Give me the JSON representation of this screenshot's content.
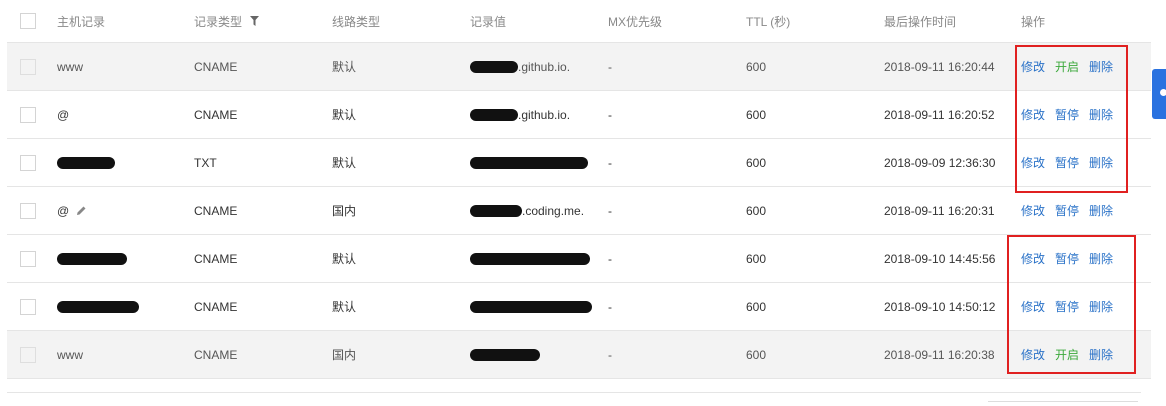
{
  "header": {
    "host": "主机记录",
    "type": "记录类型",
    "line": "线路类型",
    "value": "记录值",
    "mx": "MX优先级",
    "ttl": "TTL (秒)",
    "time": "最后操作时间",
    "op": "操作"
  },
  "colors": {
    "link": "#2a72c8",
    "enable": "#3ca93c",
    "highlight": "#e02020",
    "side_tab": "#2a72e0"
  },
  "rows": [
    {
      "host": "www",
      "host_redacted": false,
      "type": "CNAME",
      "line": "默认",
      "value_visible": ".github.io.",
      "mx": "-",
      "ttl": "600",
      "time": "2018-09-11 16:20:44",
      "edit": "修改",
      "toggle": "开启",
      "toggle_green": true,
      "del": "删除",
      "disabled": true
    },
    {
      "host": "@",
      "host_redacted": false,
      "type": "CNAME",
      "line": "默认",
      "value_visible": ".github.io.",
      "mx": "-",
      "ttl": "600",
      "time": "2018-09-11 16:20:52",
      "edit": "修改",
      "toggle": "暂停",
      "toggle_green": false,
      "del": "删除",
      "disabled": false
    },
    {
      "host": "",
      "host_redacted": true,
      "type": "TXT",
      "line": "默认",
      "value_visible": "",
      "mx": "-",
      "ttl": "600",
      "time": "2018-09-09 12:36:30",
      "edit": "修改",
      "toggle": "暂停",
      "toggle_green": false,
      "del": "删除",
      "disabled": false
    },
    {
      "host": "@",
      "host_redacted": false,
      "host_edit_icon": true,
      "type": "CNAME",
      "line": "国内",
      "value_visible": ".coding.me.",
      "mx": "-",
      "ttl": "600",
      "time": "2018-09-11 16:20:31",
      "edit": "修改",
      "toggle": "暂停",
      "toggle_green": false,
      "del": "删除",
      "disabled": false
    },
    {
      "host": "",
      "host_redacted": true,
      "type": "CNAME",
      "line": "默认",
      "value_visible": "",
      "mx": "-",
      "ttl": "600",
      "time": "2018-09-10 14:45:56",
      "edit": "修改",
      "toggle": "暂停",
      "toggle_green": false,
      "del": "删除",
      "disabled": false
    },
    {
      "host": "",
      "host_redacted": true,
      "type": "CNAME",
      "line": "默认",
      "value_visible": "",
      "mx": "-",
      "ttl": "600",
      "time": "2018-09-10 14:50:12",
      "edit": "修改",
      "toggle": "暂停",
      "toggle_green": false,
      "del": "删除",
      "disabled": false
    },
    {
      "host": "www",
      "host_redacted": false,
      "type": "CNAME",
      "line": "国内",
      "value_visible": "",
      "mx": "-",
      "ttl": "600",
      "time": "2018-09-11 16:20:38",
      "edit": "修改",
      "toggle": "开启",
      "toggle_green": true,
      "del": "删除",
      "disabled": true
    }
  ]
}
